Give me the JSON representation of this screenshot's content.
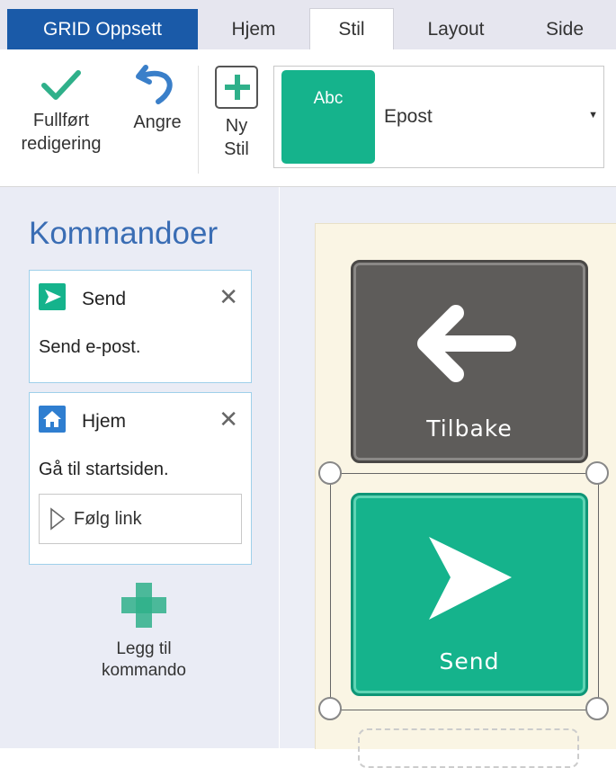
{
  "tabs": {
    "grid_setup": "GRID Oppsett",
    "home": "Hjem",
    "style": "Stil",
    "layout": "Layout",
    "page": "Side"
  },
  "ribbon": {
    "finish_line1": "Fullført",
    "finish_line2": "redigering",
    "undo": "Angre",
    "new_style_line1": "Ny",
    "new_style_line2": "Stil",
    "style_preview": "Abc",
    "style_name": "Epost"
  },
  "panel": {
    "title": "Kommandoer",
    "commands": [
      {
        "name": "Send",
        "description": "Send e-post."
      },
      {
        "name": "Hjem",
        "description": "Gå til startsiden.",
        "link_label": "Følg link"
      }
    ],
    "add_line1": "Legg til",
    "add_line2": "kommando"
  },
  "grid": {
    "back_label": "Tilbake",
    "send_label": "Send"
  },
  "colors": {
    "accent_green": "#15b38c",
    "tab_blue": "#1a5aa8",
    "back_cell": "#5e5c5a",
    "title_blue": "#3a6db4"
  }
}
